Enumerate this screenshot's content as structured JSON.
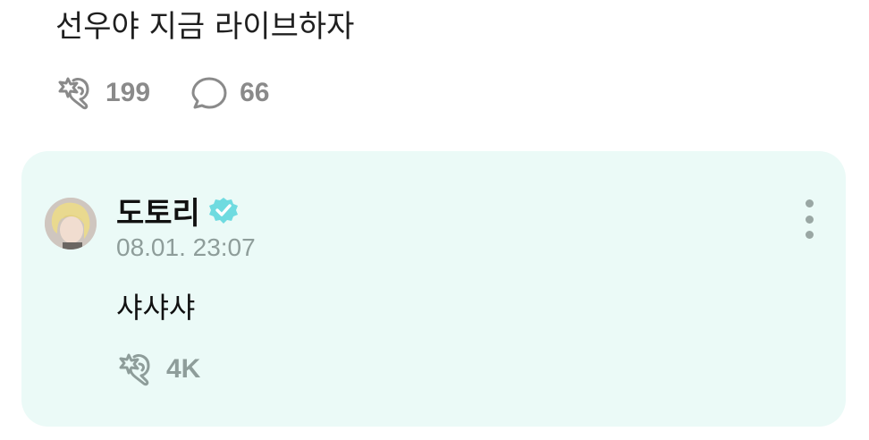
{
  "post": {
    "text": "선우야 지금 라이브하자",
    "likes": "199",
    "comments": "66"
  },
  "reply": {
    "author": "도토리",
    "timestamp": "08.01. 23:07",
    "text": "샤샤샤",
    "likes": "4K",
    "verified": true
  },
  "colors": {
    "card_bg": "#ebfaf7",
    "verified_badge": "#6fdbe0",
    "muted_text": "#8a8a8a"
  },
  "icons": {
    "like": "cheer-hand-icon",
    "comment": "speech-bubble-icon",
    "more": "vertical-ellipsis-icon",
    "verified": "verified-badge-icon"
  }
}
